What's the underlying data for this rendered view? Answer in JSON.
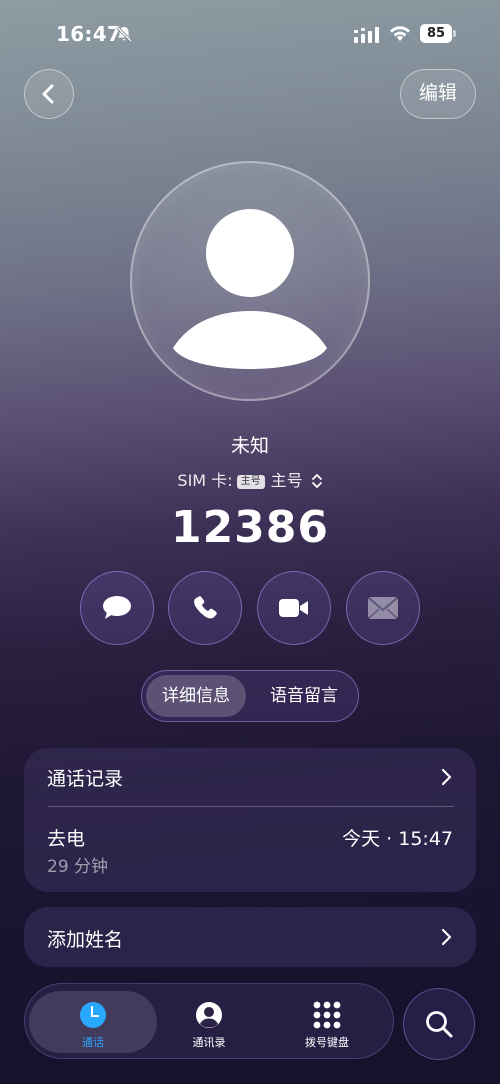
{
  "status_bar": {
    "time": "16:47",
    "battery": "85"
  },
  "header": {
    "edit_label": "编辑"
  },
  "contact": {
    "name": "未知",
    "sim_label": "SIM 卡:",
    "sim_chip": "主号",
    "sim_value": "主号",
    "number": "12386"
  },
  "tabs": {
    "details": "详细信息",
    "voicemail": "语音留言"
  },
  "call_log": {
    "title": "通话记录",
    "entry": {
      "type": "去电",
      "duration": "29 分钟",
      "time": "今天 · 15:47"
    }
  },
  "add_name": {
    "label": "添加姓名"
  },
  "nav": {
    "calls": "通话",
    "contacts": "通讯录",
    "keypad": "拨号键盘"
  },
  "colors": {
    "accent": "#2aa7ff",
    "action_border": "#aa96f0"
  },
  "icons": [
    "bell-mute-icon",
    "signal-icon",
    "wifi-icon",
    "battery-icon",
    "chevron-left-icon",
    "avatar-person-icon",
    "message-icon",
    "phone-icon",
    "video-icon",
    "mail-icon",
    "chevron-right-icon",
    "clock-icon",
    "person-icon",
    "keypad-icon",
    "search-icon",
    "updown-icon"
  ]
}
